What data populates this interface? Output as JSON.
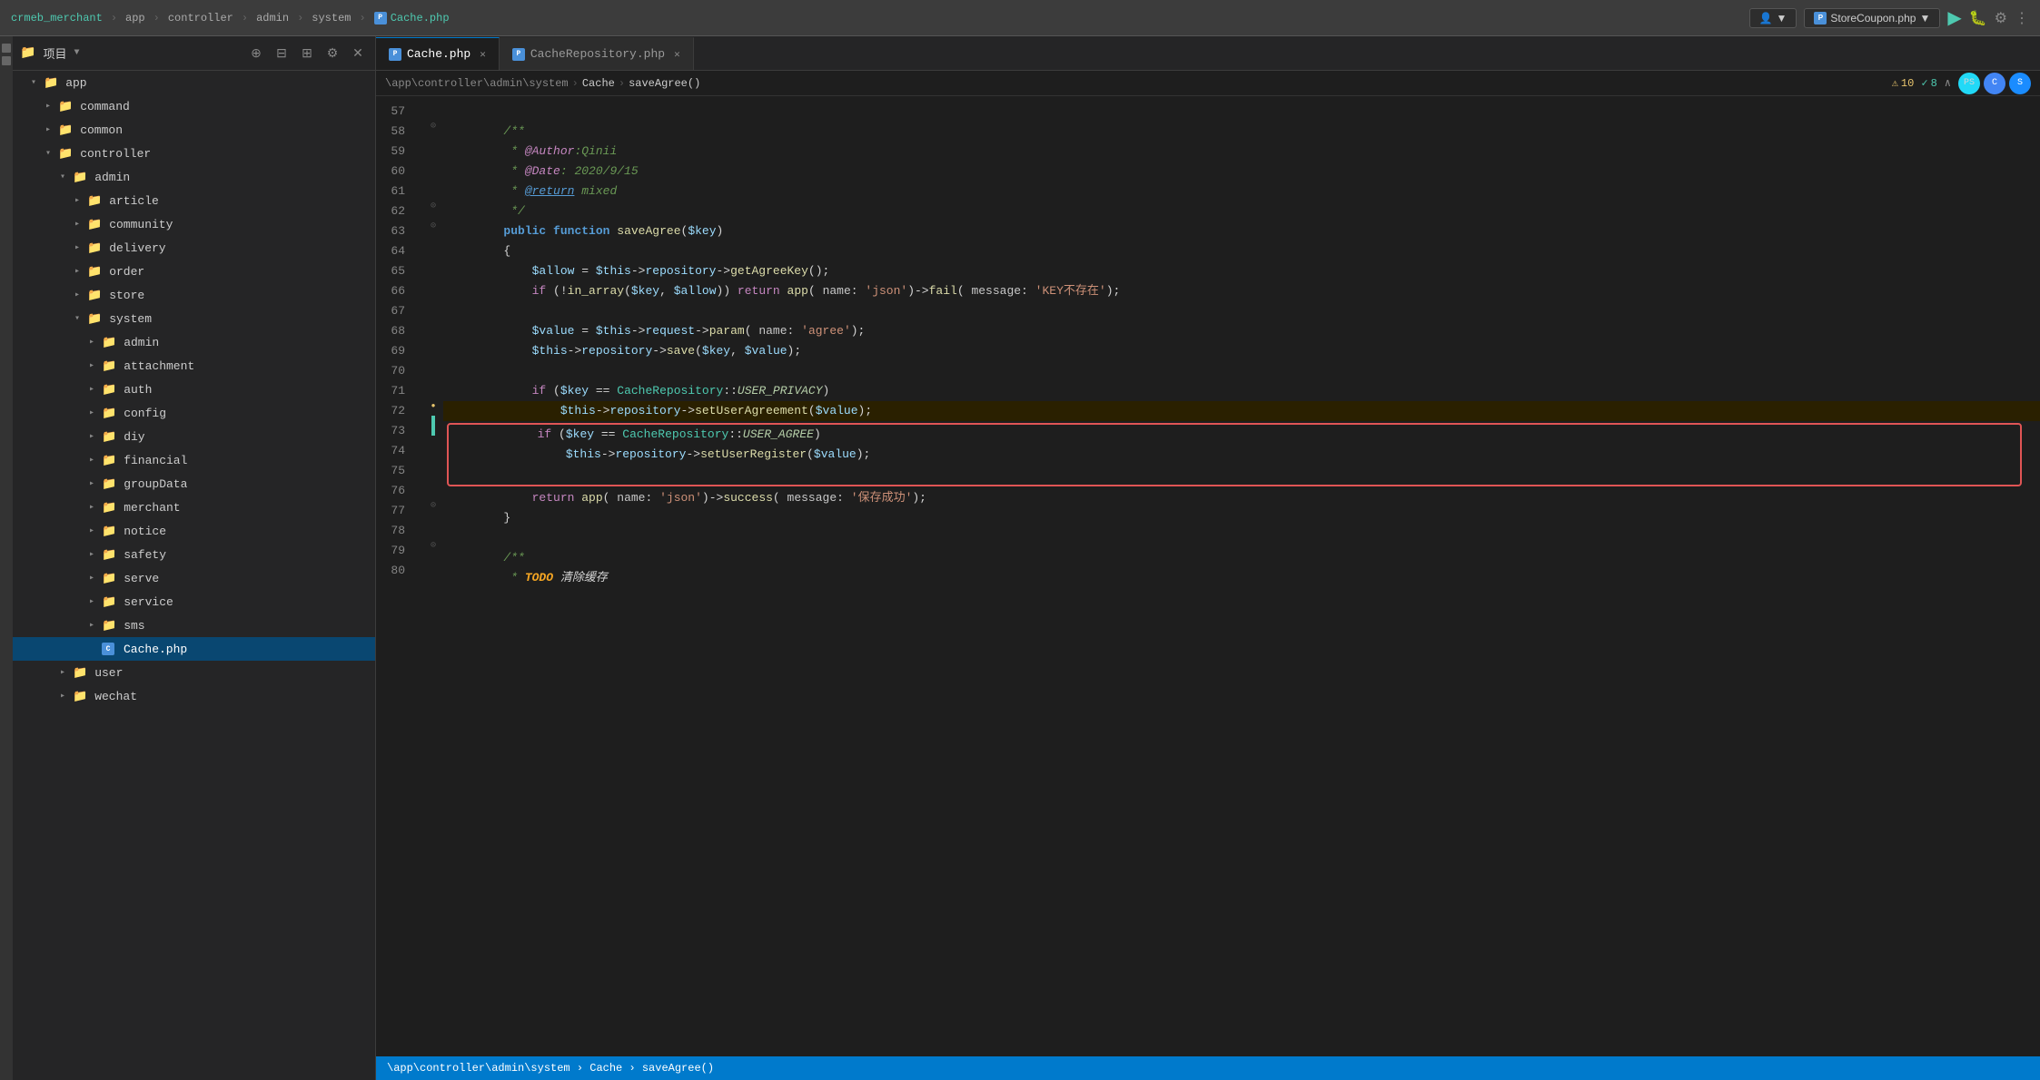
{
  "titlebar": {
    "breadcrumb": [
      "crmeb_merchant",
      "app",
      "controller",
      "admin",
      "system"
    ],
    "active_file": "Cache.php",
    "file_btn": "StoreCoupon.php",
    "user_icon_color": "#555"
  },
  "tabs": [
    {
      "label": "Cache.php",
      "active": true,
      "closable": true
    },
    {
      "label": "CacheRepository.php",
      "active": false,
      "closable": true
    }
  ],
  "editor_breadcrumb": {
    "parts": [
      "\\app\\controller\\admin\\system",
      "Cache",
      "saveAgree()"
    ]
  },
  "warnings": {
    "warn_count": "10",
    "ok_count": "8"
  },
  "sidebar": {
    "title": "项目",
    "tree": [
      {
        "level": 1,
        "label": "app",
        "type": "folder",
        "expanded": true
      },
      {
        "level": 2,
        "label": "command",
        "type": "folder",
        "expanded": false
      },
      {
        "level": 2,
        "label": "common",
        "type": "folder",
        "expanded": false
      },
      {
        "level": 2,
        "label": "controller",
        "type": "folder",
        "expanded": true
      },
      {
        "level": 3,
        "label": "admin",
        "type": "folder",
        "expanded": true
      },
      {
        "level": 4,
        "label": "article",
        "type": "folder",
        "expanded": false
      },
      {
        "level": 4,
        "label": "community",
        "type": "folder",
        "expanded": false
      },
      {
        "level": 4,
        "label": "delivery",
        "type": "folder",
        "expanded": false
      },
      {
        "level": 4,
        "label": "order",
        "type": "folder",
        "expanded": false
      },
      {
        "level": 4,
        "label": "store",
        "type": "folder",
        "expanded": false
      },
      {
        "level": 4,
        "label": "system",
        "type": "folder",
        "expanded": true
      },
      {
        "level": 5,
        "label": "admin",
        "type": "folder",
        "expanded": false
      },
      {
        "level": 5,
        "label": "attachment",
        "type": "folder",
        "expanded": false
      },
      {
        "level": 5,
        "label": "auth",
        "type": "folder",
        "expanded": false
      },
      {
        "level": 5,
        "label": "config",
        "type": "folder",
        "expanded": false
      },
      {
        "level": 5,
        "label": "diy",
        "type": "folder",
        "expanded": false
      },
      {
        "level": 5,
        "label": "financial",
        "type": "folder",
        "expanded": false
      },
      {
        "level": 5,
        "label": "groupData",
        "type": "folder",
        "expanded": false
      },
      {
        "level": 5,
        "label": "merchant",
        "type": "folder",
        "expanded": false
      },
      {
        "level": 5,
        "label": "notice",
        "type": "folder",
        "expanded": false
      },
      {
        "level": 5,
        "label": "safety",
        "type": "folder",
        "expanded": false
      },
      {
        "level": 5,
        "label": "serve",
        "type": "folder",
        "expanded": false
      },
      {
        "level": 5,
        "label": "service",
        "type": "folder",
        "expanded": false
      },
      {
        "level": 5,
        "label": "sms",
        "type": "folder",
        "expanded": false
      },
      {
        "level": 5,
        "label": "Cache.php",
        "type": "php_active",
        "expanded": false
      },
      {
        "level": 3,
        "label": "user",
        "type": "folder",
        "expanded": false
      },
      {
        "level": 3,
        "label": "wechat",
        "type": "folder",
        "expanded": false
      }
    ]
  },
  "code_lines": [
    {
      "num": 57,
      "content": "",
      "type": "normal",
      "gutter": "none"
    },
    {
      "num": 58,
      "content": "        /**",
      "type": "comment_start",
      "gutter": "fold"
    },
    {
      "num": 59,
      "content": "         * @Author:Qinii",
      "type": "comment_body",
      "gutter": "none"
    },
    {
      "num": 60,
      "content": "         * @Date: 2020/9/15",
      "type": "comment_body",
      "gutter": "none"
    },
    {
      "num": 61,
      "content": "         * @return mixed",
      "type": "comment_return",
      "gutter": "none"
    },
    {
      "num": 62,
      "content": "         */",
      "type": "comment_end",
      "gutter": "fold_end"
    },
    {
      "num": 63,
      "content": "        public function saveAgree($key)",
      "type": "func_def",
      "gutter": "fold"
    },
    {
      "num": 64,
      "content": "        {",
      "type": "normal",
      "gutter": "none"
    },
    {
      "num": 65,
      "content": "            $allow = $this->repository->getAgreeKey();",
      "type": "normal",
      "gutter": "none"
    },
    {
      "num": 66,
      "content": "            if (!in_array($key, $allow)) return app( name: 'json')->fail( message: 'KEY不存在');",
      "type": "normal",
      "gutter": "none"
    },
    {
      "num": 67,
      "content": "",
      "type": "normal",
      "gutter": "none"
    },
    {
      "num": 68,
      "content": "            $value = $this->request->param( name: 'agree');",
      "type": "normal",
      "gutter": "none"
    },
    {
      "num": 69,
      "content": "            $this->repository->save($key, $value);",
      "type": "normal",
      "gutter": "none"
    },
    {
      "num": 70,
      "content": "",
      "type": "normal",
      "gutter": "none"
    },
    {
      "num": 71,
      "content": "            if ($key == CacheRepository::USER_PRIVACY)",
      "type": "normal",
      "gutter": "none"
    },
    {
      "num": 72,
      "content": "                $this->repository->setUserAgreement($value);",
      "type": "highlighted",
      "gutter": "yellow_dot"
    },
    {
      "num": 73,
      "content": "            if ($key == CacheRepository::USER_AGREE)",
      "type": "boxed1",
      "gutter": "green_bar"
    },
    {
      "num": 74,
      "content": "                $this->repository->setUserRegister($value);",
      "type": "boxed2",
      "gutter": "none"
    },
    {
      "num": 75,
      "content": "",
      "type": "boxed3",
      "gutter": "none"
    },
    {
      "num": 76,
      "content": "            return app( name: 'json')->success( message: '保存成功');",
      "type": "normal",
      "gutter": "none"
    },
    {
      "num": 77,
      "content": "        }",
      "type": "normal",
      "gutter": "fold_end"
    },
    {
      "num": 78,
      "content": "",
      "type": "normal",
      "gutter": "none"
    },
    {
      "num": 79,
      "content": "        /**",
      "type": "comment_start",
      "gutter": "fold"
    },
    {
      "num": 80,
      "content": "         * TODO 清除缓存",
      "type": "comment_todo",
      "gutter": "none"
    }
  ],
  "statusbar": {
    "path": "\\app\\controller\\admin\\system  ›  Cache  ›  saveAgree()"
  }
}
